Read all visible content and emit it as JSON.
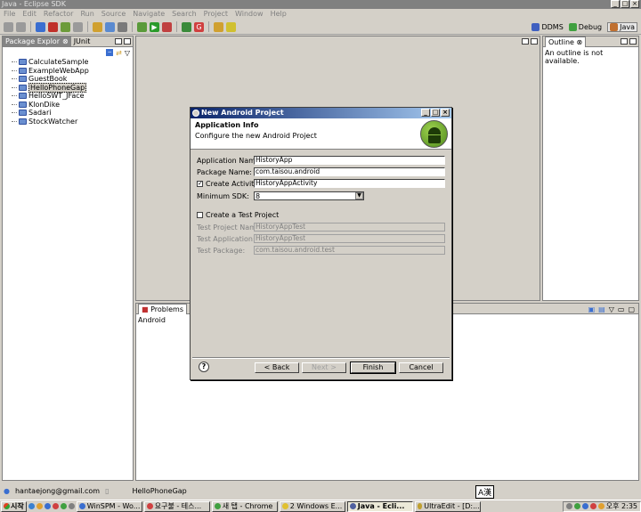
{
  "window": {
    "title": "Java - Eclipse SDK"
  },
  "menu": [
    "File",
    "Edit",
    "Refactor",
    "Run",
    "Source",
    "Navigate",
    "Search",
    "Project",
    "Window",
    "Help"
  ],
  "perspectives": {
    "ddms": "DDMS",
    "debug": "Debug",
    "java": "Java"
  },
  "package_explorer": {
    "tab_label": "Package Explor",
    "junit_tab": "JUnit",
    "projects": [
      "CalculateSample",
      "ExampleWebApp",
      "GuestBook",
      "HelloPhoneGap",
      "HelloSWT_JFace",
      "KlonDike",
      "Sadari",
      "StockWatcher"
    ],
    "selected": "HelloPhoneGap"
  },
  "outline": {
    "tab_label": "Outline",
    "message": "An outline is not available."
  },
  "problems": {
    "tab_label": "Problems",
    "row": "Android"
  },
  "dialog": {
    "title": "New Android Project",
    "heading": "Application Info",
    "subheading": "Configure the new Android Project",
    "app_name_label": "Application Name:",
    "app_name": "HistoryApp",
    "package_label": "Package Name:",
    "package": "com.taisou.android",
    "create_activity_label": "Create Activity:",
    "create_activity_checked": true,
    "activity": "HistoryAppActivity",
    "min_sdk_label": "Minimum SDK:",
    "min_sdk": "8",
    "test_project_label": "Create a Test Project",
    "test_project_checked": false,
    "test_name_label": "Test Project Name:",
    "test_name": "HistoryAppTest",
    "test_app_label": "Test Application:",
    "test_app": "HistoryAppTest",
    "test_pkg_label": "Test Package:",
    "test_pkg": "com.taisou.android.test",
    "back": "< Back",
    "next": "Next >",
    "finish": "Finish",
    "cancel": "Cancel"
  },
  "status": {
    "email": "hantaejong@gmail.com",
    "selection": "HelloPhoneGap",
    "ime": "A漢"
  },
  "taskbar": {
    "start": "시작",
    "tasks": [
      "WinSPM - Wo...",
      "요구불 - 테스...",
      "새 탭 - Chrome",
      "2 Windows E...",
      "Java - Ecli...",
      "UltraEdit - [D:..."
    ],
    "active_task": 4,
    "clock": "오후 2:35"
  }
}
